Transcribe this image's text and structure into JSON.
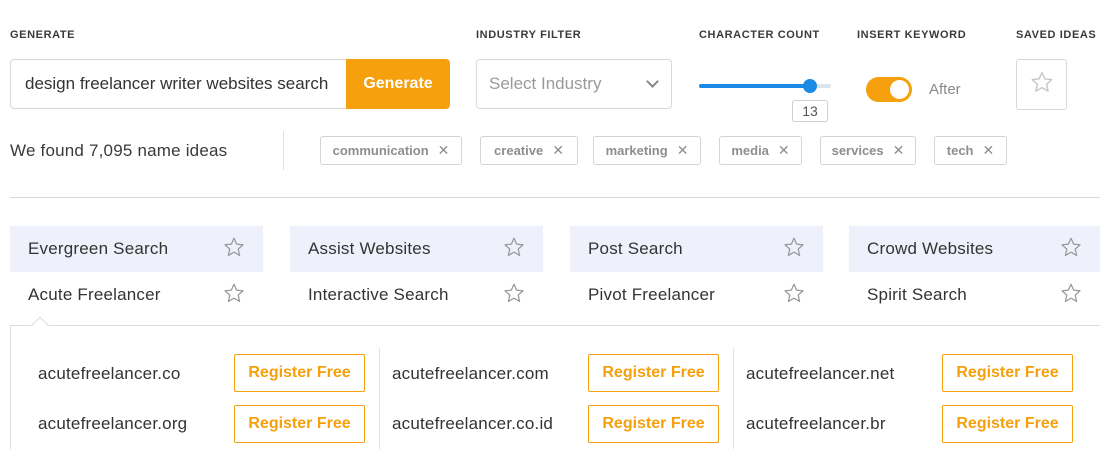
{
  "headers": {
    "generate": "GENERATE",
    "industry": "INDUSTRY FILTER",
    "charcount": "CHARACTER COUNT",
    "keyword": "INSERT KEYWORD",
    "saved": "SAVED IDEAS"
  },
  "search": {
    "value": "design freelancer writer websites search",
    "button": "Generate"
  },
  "industry": {
    "placeholder": "Select Industry"
  },
  "character_count": {
    "value": 13,
    "fill_fraction": 0.84
  },
  "keyword": {
    "toggle_on": true,
    "label": "After"
  },
  "results": {
    "found_text": "We found 7,095 name ideas"
  },
  "chips": [
    {
      "label": "communication"
    },
    {
      "label": "creative"
    },
    {
      "label": "marketing"
    },
    {
      "label": "media"
    },
    {
      "label": "services"
    },
    {
      "label": "tech"
    }
  ],
  "names": [
    [
      "Evergreen Search",
      "Assist Websites",
      "Post Search",
      "Crowd Websites"
    ],
    [
      "Acute Freelancer",
      "Interactive Search",
      "Pivot Freelancer",
      "Spirit Search"
    ]
  ],
  "domains": [
    [
      "acutefreelancer.co",
      "acutefreelancer.com",
      "acutefreelancer.net"
    ],
    [
      "acutefreelancer.org",
      "acutefreelancer.co.id",
      "acutefreelancer.br"
    ]
  ],
  "register_label": "Register Free",
  "colors": {
    "accent": "#f5a00c",
    "slider": "#1a8ae5",
    "highlight_row": "#eef1fb"
  }
}
